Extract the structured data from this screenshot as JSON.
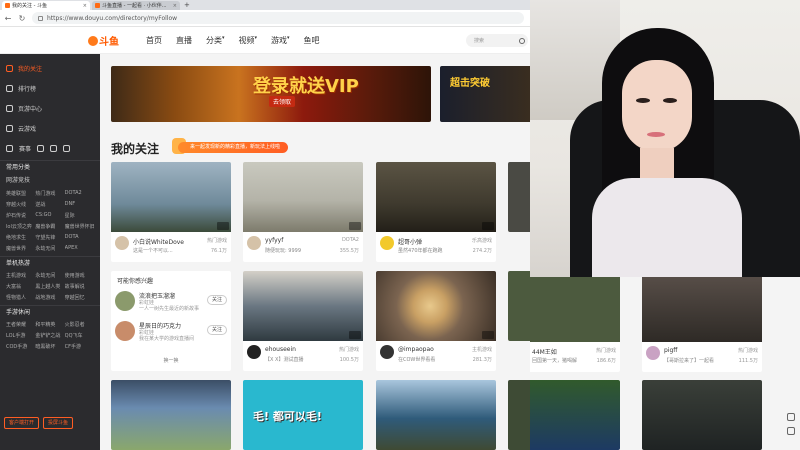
{
  "browser": {
    "tabs": [
      {
        "label": "我的关注 - 斗鱼",
        "active": true
      },
      {
        "label": "斗鱼直播 - 一起看 · 小伙伴...",
        "active": false
      }
    ],
    "new_tab": "+",
    "url": "https://www.douyu.com/directory/myFollow"
  },
  "header": {
    "logo_text": "斗鱼",
    "nav": [
      "首页",
      "直播",
      "分类",
      "视频",
      "游戏",
      "鱼吧"
    ],
    "search_placeholder": "搜索"
  },
  "sidebar": {
    "items": [
      "我的关注",
      "排行榜",
      "页游中心",
      "云游戏"
    ],
    "row_labels": [
      "赛事",
      "",
      ""
    ],
    "section_hot": "常用分类",
    "hot_heading": "网游竞技",
    "hot_categories": [
      "英雄联盟",
      "热门游戏",
      "DOTA2",
      "穿越火线",
      "逆战",
      "DNF",
      "炉石传说",
      "CS:GO",
      "星际",
      "lol云顶之弈",
      "魔兽争霸",
      "魔兽世界怀旧",
      "绝地求生",
      "守望先锋",
      "DOTA",
      "魔兽世界",
      "永劫无间",
      "APEX"
    ],
    "section_mobile": "单机热游",
    "mobile_categories": [
      "主机游戏",
      "永劫无间",
      "使用游戏",
      "大富翁",
      "黑上越人类",
      "故事解说",
      "怪物猎人",
      "战地游戏",
      "穿越回忆"
    ],
    "section_hand": "手游休闲",
    "hand_categories": [
      "王者荣耀",
      "和平精英",
      "火影忍者",
      "LOL手游",
      "金铲铲之战",
      "QQ飞车",
      "COD手游",
      "暗黑破坏",
      "CF手游"
    ],
    "bottom_buttons": [
      "客户端打开",
      "投屏斗鱼"
    ]
  },
  "content": {
    "banner1": {
      "headline": "登录就送VIP",
      "sub": "去领取"
    },
    "banner2": {
      "headline": "超击突破"
    },
    "section_title": "我的关注",
    "promo_pill": "来一起发现新的精彩直播，新玩法上线啦",
    "cards": [
      {
        "name": "小白说WhiteDove",
        "category": "热门游戏",
        "title": "这是一个不可以...",
        "views": "76.1万",
        "thumb": "#6f8a9a"
      },
      {
        "name": "yyfyyf",
        "category": "DOTA2",
        "title": "随便玩玩: 9999",
        "views": "355.5万",
        "thumb": "#b4b3a8"
      },
      {
        "name": "超哥小弹",
        "category": "乐高游戏",
        "title": "虽然470年都在跑跑",
        "views": "274.2万",
        "thumb": "#3f3a2e"
      },
      {
        "name": "ehouseein",
        "category": "热门游戏",
        "title": "【X X】测试直播",
        "views": "100.5万",
        "thumb": "#6a7782"
      },
      {
        "name": "@impaopao",
        "category": "主机游戏",
        "title": "在COW世界看看",
        "views": "281.3万",
        "thumb": "#7b6450"
      },
      {
        "name": "44M王如",
        "category": "热门游戏",
        "title": "回国第一天，猪喝解",
        "views": "186.6万",
        "thumb": "#4c5a3e"
      },
      {
        "name": "pigff",
        "category": "热门游戏",
        "title": "【哥斯拉来了】一起看",
        "views": "111.5万",
        "thumb": "#2e2a26"
      }
    ],
    "recommend": {
      "title": "可能你感兴趣",
      "items": [
        {
          "name": "流浪把玉溜溜",
          "sub": "彩虹娃",
          "desc": "一人一树先生最近的新故事",
          "follow": "关注"
        },
        {
          "name": "星辰日的巧克力",
          "sub": "彩虹娃",
          "desc": "我在某大学的游戏直播间",
          "follow": "关注"
        }
      ],
      "more": "换一换"
    },
    "bottom_thumbs": [
      "#6a8bb0",
      "#29b8cf",
      "#2f5b7a",
      "#3e4b35",
      "#1f2323"
    ],
    "bottom_texts": [
      "毛! 都可以毛!"
    ]
  },
  "colors": {
    "accent": "#ff5d23",
    "sidebar_bg": "#2b2b2e",
    "content_bg": "#f4f4f4"
  }
}
